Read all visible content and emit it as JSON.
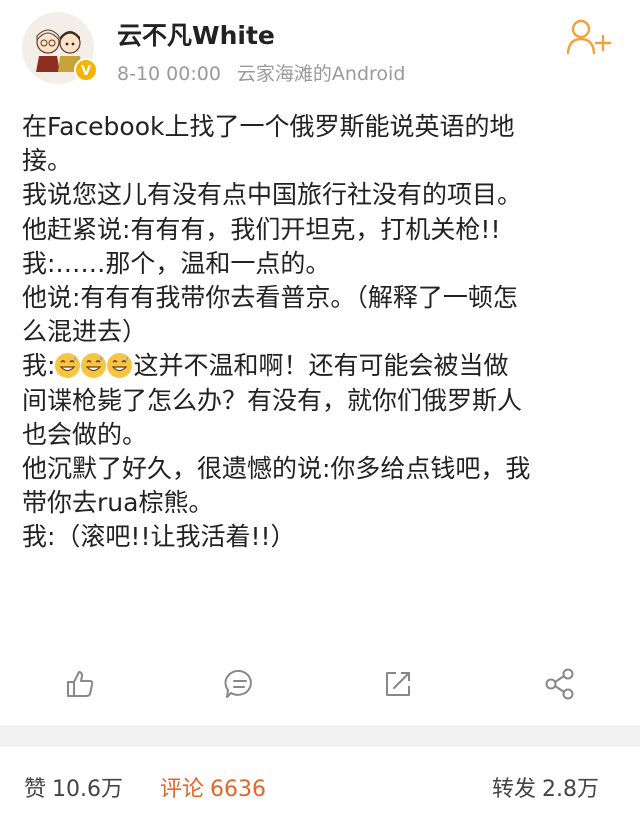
{
  "header": {
    "username": "云不凡White",
    "date": "8-10 00:00",
    "source": "云家海滩的Android"
  },
  "post": {
    "lines": [
      "在Facebook上找了一个俄罗斯能说英语的地",
      "接。",
      "我说您这儿有没有点中国旅行社没有的项目。",
      "他赶紧说:有有有，我们开坦克，打机关枪!!",
      "我:……那个，温和一点的。",
      "他说:有有有我带你去看普京。（解释了一顿怎",
      "么混进去）",
      "这并不温和啊！还有可能会被当做",
      "间谍枪毙了怎么办？有没有，就你们俄罗斯人",
      "也会做的。",
      "他沉默了好久，很遗憾的说:你多给点钱吧，我",
      "带你去rua棕熊。",
      "我:（滚吧!!让我活着!!）"
    ],
    "line8_prefix": "我:",
    "emoji_name": "grinning-sweat-emoji"
  },
  "stats": {
    "likes_label": "赞",
    "likes_count": "10.6万",
    "comments_label": "评论",
    "comments_count": "6636",
    "reposts_label": "转发",
    "reposts_count": "2.8万"
  },
  "colors": {
    "accent": "#e2672a",
    "follow_icon": "#f0a23b",
    "verified": "#f6b400",
    "meta_gray": "#9a9a9a"
  },
  "icons": [
    "follow-icon",
    "like-icon",
    "comment-icon",
    "repost-icon",
    "share-icon",
    "verified-badge-icon"
  ]
}
